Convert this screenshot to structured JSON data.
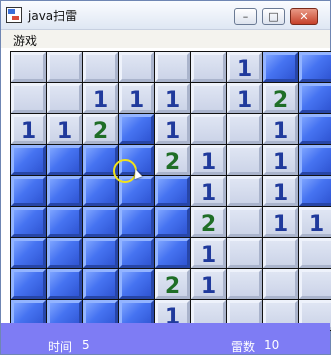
{
  "window": {
    "title": "java扫雷",
    "controls": {
      "minimize": "–",
      "maximize": "□",
      "close": "✕"
    }
  },
  "menu": {
    "items": [
      "游戏"
    ]
  },
  "board": {
    "rows": [
      [
        "o",
        "o",
        "o",
        "o",
        "o",
        "o",
        "1",
        "c",
        "c"
      ],
      [
        "o",
        "o",
        "1",
        "1",
        "1",
        "o",
        "1",
        "2",
        "c"
      ],
      [
        "1",
        "1",
        "2",
        "c",
        "1",
        "o",
        "o",
        "1",
        "c"
      ],
      [
        "c",
        "c",
        "c",
        "c",
        "2",
        "1",
        "o",
        "1",
        "c"
      ],
      [
        "c",
        "c",
        "c",
        "c",
        "c",
        "1",
        "o",
        "1",
        "c"
      ],
      [
        "c",
        "c",
        "c",
        "c",
        "c",
        "2",
        "o",
        "1",
        "1"
      ],
      [
        "c",
        "c",
        "c",
        "c",
        "c",
        "1",
        "o",
        "o",
        "o"
      ],
      [
        "c",
        "c",
        "c",
        "c",
        "2",
        "1",
        "o",
        "o",
        "o"
      ],
      [
        "c",
        "c",
        "c",
        "c",
        "1",
        "o",
        "o",
        "o",
        "o"
      ]
    ],
    "legend": {
      "o": "opened-empty",
      "c": "covered"
    }
  },
  "status": {
    "time_label": "时间",
    "time_value": "5",
    "mines_label": "雷数",
    "mines_value": "10"
  }
}
